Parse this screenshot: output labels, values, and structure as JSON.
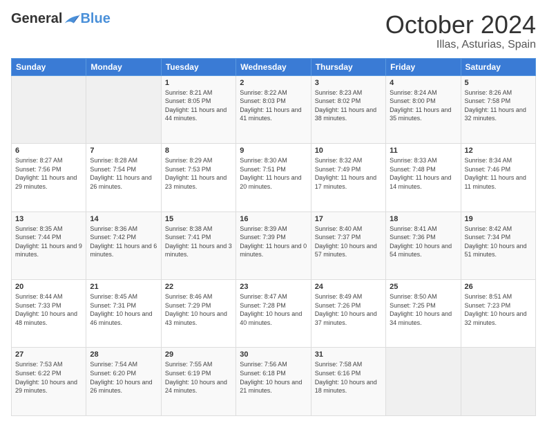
{
  "header": {
    "logo_general": "General",
    "logo_blue": "Blue",
    "month_title": "October 2024",
    "location": "Illas, Asturias, Spain"
  },
  "weekdays": [
    "Sunday",
    "Monday",
    "Tuesday",
    "Wednesday",
    "Thursday",
    "Friday",
    "Saturday"
  ],
  "weeks": [
    [
      {
        "day": "",
        "empty": true
      },
      {
        "day": "",
        "empty": true
      },
      {
        "day": "1",
        "sunrise": "8:21 AM",
        "sunset": "8:05 PM",
        "daylight": "11 hours and 44 minutes."
      },
      {
        "day": "2",
        "sunrise": "8:22 AM",
        "sunset": "8:03 PM",
        "daylight": "11 hours and 41 minutes."
      },
      {
        "day": "3",
        "sunrise": "8:23 AM",
        "sunset": "8:02 PM",
        "daylight": "11 hours and 38 minutes."
      },
      {
        "day": "4",
        "sunrise": "8:24 AM",
        "sunset": "8:00 PM",
        "daylight": "11 hours and 35 minutes."
      },
      {
        "day": "5",
        "sunrise": "8:26 AM",
        "sunset": "7:58 PM",
        "daylight": "11 hours and 32 minutes."
      }
    ],
    [
      {
        "day": "6",
        "sunrise": "8:27 AM",
        "sunset": "7:56 PM",
        "daylight": "11 hours and 29 minutes."
      },
      {
        "day": "7",
        "sunrise": "8:28 AM",
        "sunset": "7:54 PM",
        "daylight": "11 hours and 26 minutes."
      },
      {
        "day": "8",
        "sunrise": "8:29 AM",
        "sunset": "7:53 PM",
        "daylight": "11 hours and 23 minutes."
      },
      {
        "day": "9",
        "sunrise": "8:30 AM",
        "sunset": "7:51 PM",
        "daylight": "11 hours and 20 minutes."
      },
      {
        "day": "10",
        "sunrise": "8:32 AM",
        "sunset": "7:49 PM",
        "daylight": "11 hours and 17 minutes."
      },
      {
        "day": "11",
        "sunrise": "8:33 AM",
        "sunset": "7:48 PM",
        "daylight": "11 hours and 14 minutes."
      },
      {
        "day": "12",
        "sunrise": "8:34 AM",
        "sunset": "7:46 PM",
        "daylight": "11 hours and 11 minutes."
      }
    ],
    [
      {
        "day": "13",
        "sunrise": "8:35 AM",
        "sunset": "7:44 PM",
        "daylight": "11 hours and 9 minutes."
      },
      {
        "day": "14",
        "sunrise": "8:36 AM",
        "sunset": "7:42 PM",
        "daylight": "11 hours and 6 minutes."
      },
      {
        "day": "15",
        "sunrise": "8:38 AM",
        "sunset": "7:41 PM",
        "daylight": "11 hours and 3 minutes."
      },
      {
        "day": "16",
        "sunrise": "8:39 AM",
        "sunset": "7:39 PM",
        "daylight": "11 hours and 0 minutes."
      },
      {
        "day": "17",
        "sunrise": "8:40 AM",
        "sunset": "7:37 PM",
        "daylight": "10 hours and 57 minutes."
      },
      {
        "day": "18",
        "sunrise": "8:41 AM",
        "sunset": "7:36 PM",
        "daylight": "10 hours and 54 minutes."
      },
      {
        "day": "19",
        "sunrise": "8:42 AM",
        "sunset": "7:34 PM",
        "daylight": "10 hours and 51 minutes."
      }
    ],
    [
      {
        "day": "20",
        "sunrise": "8:44 AM",
        "sunset": "7:33 PM",
        "daylight": "10 hours and 48 minutes."
      },
      {
        "day": "21",
        "sunrise": "8:45 AM",
        "sunset": "7:31 PM",
        "daylight": "10 hours and 46 minutes."
      },
      {
        "day": "22",
        "sunrise": "8:46 AM",
        "sunset": "7:29 PM",
        "daylight": "10 hours and 43 minutes."
      },
      {
        "day": "23",
        "sunrise": "8:47 AM",
        "sunset": "7:28 PM",
        "daylight": "10 hours and 40 minutes."
      },
      {
        "day": "24",
        "sunrise": "8:49 AM",
        "sunset": "7:26 PM",
        "daylight": "10 hours and 37 minutes."
      },
      {
        "day": "25",
        "sunrise": "8:50 AM",
        "sunset": "7:25 PM",
        "daylight": "10 hours and 34 minutes."
      },
      {
        "day": "26",
        "sunrise": "8:51 AM",
        "sunset": "7:23 PM",
        "daylight": "10 hours and 32 minutes."
      }
    ],
    [
      {
        "day": "27",
        "sunrise": "7:53 AM",
        "sunset": "6:22 PM",
        "daylight": "10 hours and 29 minutes."
      },
      {
        "day": "28",
        "sunrise": "7:54 AM",
        "sunset": "6:20 PM",
        "daylight": "10 hours and 26 minutes."
      },
      {
        "day": "29",
        "sunrise": "7:55 AM",
        "sunset": "6:19 PM",
        "daylight": "10 hours and 24 minutes."
      },
      {
        "day": "30",
        "sunrise": "7:56 AM",
        "sunset": "6:18 PM",
        "daylight": "10 hours and 21 minutes."
      },
      {
        "day": "31",
        "sunrise": "7:58 AM",
        "sunset": "6:16 PM",
        "daylight": "10 hours and 18 minutes."
      },
      {
        "day": "",
        "empty": true
      },
      {
        "day": "",
        "empty": true
      }
    ]
  ]
}
